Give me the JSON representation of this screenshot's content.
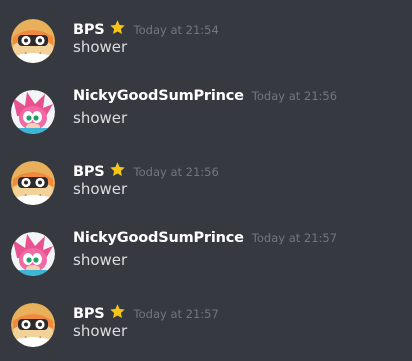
{
  "messages": [
    {
      "username": "BPS",
      "has_star": true,
      "timestamp": "Today at 21:54",
      "content": "shower",
      "avatar": "bps-avatar"
    },
    {
      "username": "NickyGoodSumPrince",
      "has_star": false,
      "timestamp": "Today at 21:56",
      "content": "shower",
      "avatar": "pink-hedgehog-avatar"
    },
    {
      "username": "BPS",
      "has_star": true,
      "timestamp": "Today at 21:56",
      "content": "shower",
      "avatar": "bps-avatar"
    },
    {
      "username": "NickyGoodSumPrince",
      "has_star": false,
      "timestamp": "Today at 21:57",
      "content": "shower",
      "avatar": "pink-hedgehog-avatar"
    },
    {
      "username": "BPS",
      "has_star": true,
      "timestamp": "Today at 21:57",
      "content": "shower",
      "avatar": "bps-avatar"
    }
  ],
  "colors": {
    "background": "#36393f",
    "username": "#ffffff",
    "timestamp": "#72767d",
    "message_text": "#dcddde",
    "star": "#f5c518"
  }
}
